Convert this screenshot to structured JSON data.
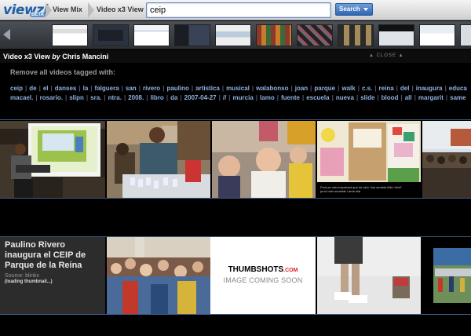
{
  "header": {
    "logo_text": "viewzi",
    "logo_badge": "BETA",
    "nav": [
      {
        "label": "View Mix"
      },
      {
        "label": "Video x3 View"
      }
    ],
    "search": {
      "value": "ceip",
      "button_label": "Search"
    }
  },
  "view": {
    "title_prefix": "Video x3 View",
    "title_by": "by",
    "author": "Chris Mancini",
    "close_label": "▲ CLOSE ▲"
  },
  "tags": {
    "heading": "Remove all videos tagged with:",
    "row1": [
      "ceip",
      "de",
      "el",
      "danses",
      "la",
      "falguera",
      "san",
      "rivero",
      "paulino",
      "artistica",
      "musical",
      "walabonso",
      "joan",
      "parque",
      "walk",
      "c.s.",
      "reina",
      "del",
      "inaugura",
      "educa"
    ],
    "row2": [
      "macael.",
      "rosario.",
      "slipn",
      "sra.",
      "ntra.",
      "2008.",
      "libro",
      "da",
      "2007-04-27",
      "//",
      "murcia",
      "lamo",
      "fuente",
      "escuela",
      "nueva",
      "slide",
      "blood",
      "all",
      "margarit",
      "same"
    ]
  },
  "results": {
    "row1_caption": "Fent-se més important que tot això \"ara sembla féliz i llest\" \n ja es més sensible i amb ella",
    "featured_video": {
      "title": "Paulino Rivero inaugura el CEIP de Parque de la Reina",
      "source": "Source: blinkx",
      "status": "(loading thumbnail...)"
    },
    "placeholder": {
      "brand": "THUMBSHOTS",
      "brand_suffix": ".COM",
      "message": "IMAGE COMING SOON"
    }
  },
  "colors": {
    "accent": "#2f66b2",
    "tag_link": "#8fb1df",
    "rule": "#3b5b86"
  }
}
